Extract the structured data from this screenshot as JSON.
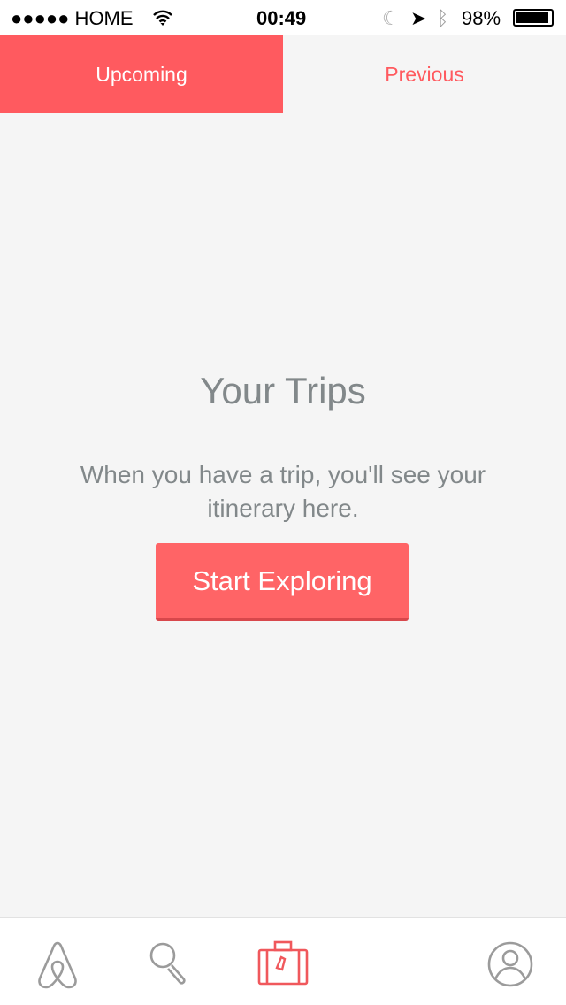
{
  "status_bar": {
    "carrier": "●●●●● HOME",
    "time": "00:49",
    "battery": "98%",
    "icons": [
      "wifi-icon",
      "moon-icon",
      "location-icon",
      "bluetooth-icon",
      "battery-icon"
    ]
  },
  "tabs": [
    {
      "label": "Upcoming",
      "active": true
    },
    {
      "label": "Previous",
      "active": false
    }
  ],
  "main": {
    "title": "Your Trips",
    "message": "When you have a trip, you'll see your itinerary here.",
    "button": "Start Exploring"
  },
  "bottom_nav": {
    "items": [
      {
        "icon": "airbnb-logo-icon",
        "active": false
      },
      {
        "icon": "search-icon",
        "active": false
      },
      {
        "icon": "suitcase-icon",
        "active": true
      },
      {
        "icon": "profile-icon",
        "active": false
      }
    ]
  },
  "colors": {
    "accent": "#ff5a5f",
    "text": "#82888a",
    "inactive_icon": "#9b9b9b"
  }
}
